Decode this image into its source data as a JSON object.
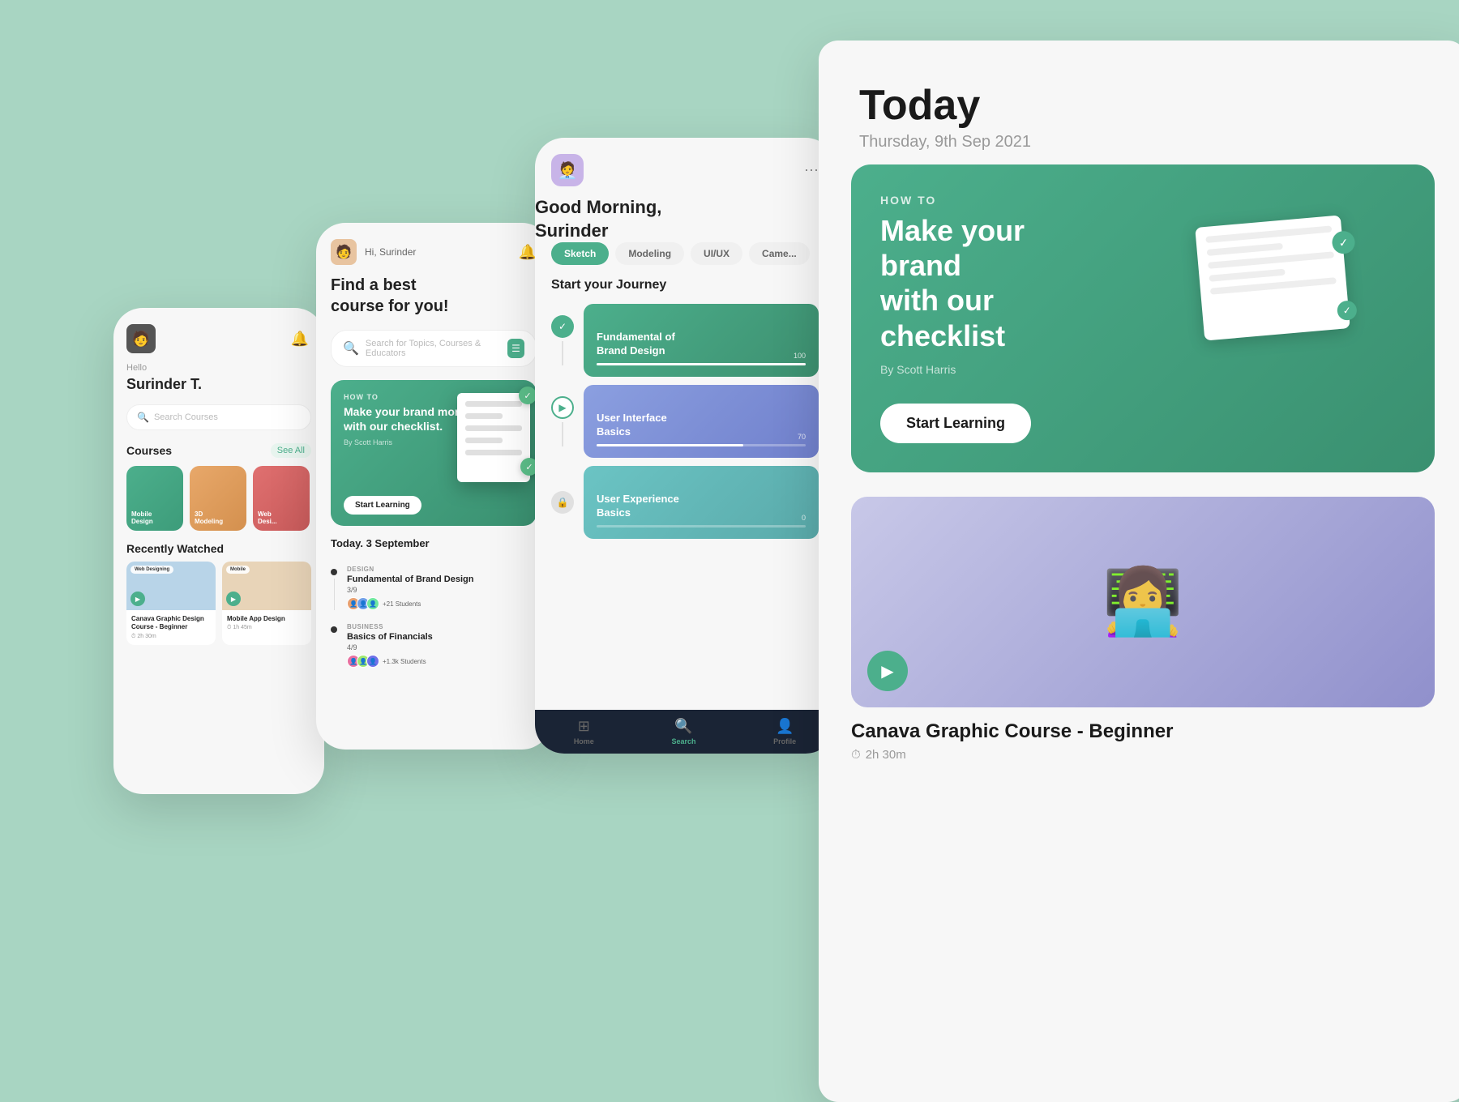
{
  "background": {
    "color": "#a8d5c2"
  },
  "screen1": {
    "greeting": "Hello",
    "name": "Surinder T.",
    "search_placeholder": "Search Courses",
    "courses_title": "Courses",
    "see_all": "See All",
    "courses": [
      {
        "label": "Mobile Design",
        "color": "green"
      },
      {
        "label": "3D Modeling",
        "color": "orange"
      },
      {
        "label": "Web Design",
        "color": "red"
      }
    ],
    "recently_watched": "Recently Watched",
    "watched_items": [
      {
        "badge": "Web Designing",
        "title": "Canava Graphic Design Course - Beginner",
        "time": "2h 30m"
      },
      {
        "badge": "Mobile",
        "title": "Mobile App Design",
        "time": "1h 45m"
      }
    ]
  },
  "screen2": {
    "hi": "Hi, Surinder",
    "title": "Find a best\ncourse for you!",
    "search_placeholder": "Search for Topics, Courses & Educators",
    "banner": {
      "label": "HOW TO",
      "title": "Make your brand more visible with our checklist.",
      "author": "By Scott Harris",
      "btn": "Start Learning"
    },
    "today_label": "Today. 3 September",
    "schedule": [
      {
        "category": "DESIGN",
        "title": "Fundamental of Brand Design",
        "progress": "3/9",
        "students_text": "+21 Students"
      },
      {
        "category": "BUSINESS",
        "title": "Basics of Financials",
        "progress": "4/9",
        "students_text": "+1.3k Students"
      }
    ]
  },
  "screen3": {
    "greeting": "Good Morning,\nSurinder",
    "tabs": [
      "Sketch",
      "Modeling",
      "UI/UX",
      "Camera"
    ],
    "active_tab": "Sketch",
    "journey_title": "Start your Journey",
    "journey_items": [
      {
        "title": "Fundamental of\nBrand Design",
        "color": "green-card",
        "progress": 100,
        "status": "done"
      },
      {
        "title": "User Interface\nBasics",
        "color": "blue-card",
        "progress": 70,
        "status": "playing"
      },
      {
        "title": "User Experience\nBasics",
        "color": "teal-card",
        "progress": 0,
        "status": "locked"
      }
    ],
    "nav": [
      {
        "label": "Home",
        "icon": "⊞",
        "active": false
      },
      {
        "label": "Search",
        "icon": "🔍",
        "active": true
      },
      {
        "label": "Profile",
        "icon": "👤",
        "active": false
      }
    ]
  },
  "screen4": {
    "date_label": "Today",
    "date_sub": "Thursday, 9th Sep 2021",
    "banner": {
      "label": "HOW TO",
      "title": "Make your brand\nwith our checklist",
      "author": "By Scott Harris",
      "btn": "Start Learning"
    },
    "second_video": {
      "title": "Canava Graphic Course - Beginner",
      "time": "2h 30m"
    }
  }
}
